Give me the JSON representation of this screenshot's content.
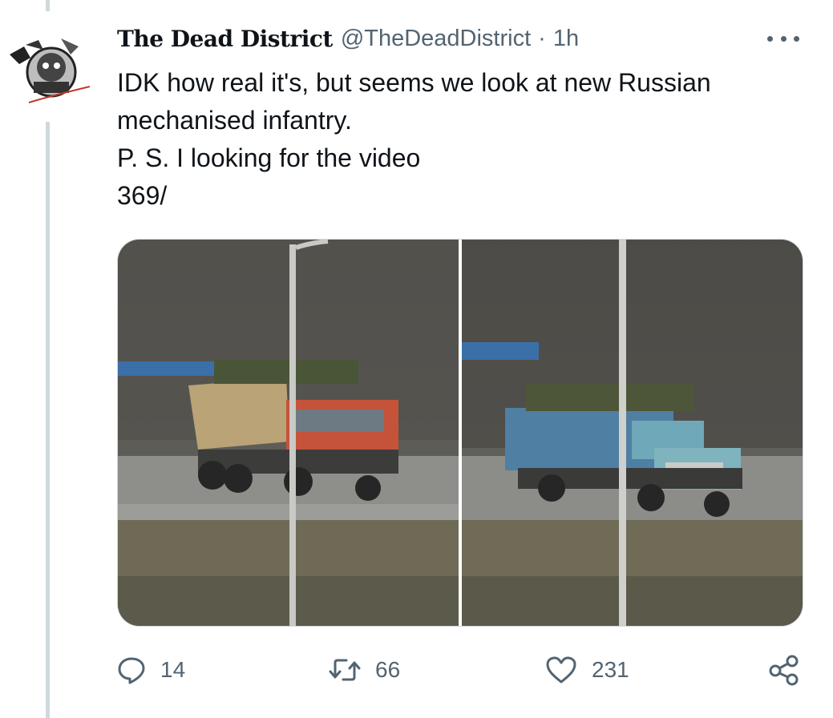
{
  "tweet": {
    "display_name": "The Dead District",
    "handle": "@TheDeadDistrict",
    "separator": "·",
    "time": "1h",
    "text_lines": [
      "IDK how real it's, but seems we look at new Russian",
      "mechanised infantry.",
      "P. S. I looking for the video",
      "369/"
    ]
  },
  "media": {
    "left_photo": "dump-truck-with-soldiers",
    "right_photo": "blue-truck-with-soldiers"
  },
  "actions": {
    "replies": "14",
    "retweets": "66",
    "likes": "231"
  },
  "colors": {
    "text": "#0f1419",
    "secondary": "#536471",
    "thread_line": "#cfd9de",
    "border": "#cfd9de"
  },
  "icons": [
    "more-icon",
    "reply-icon",
    "retweet-icon",
    "like-icon",
    "share-icon"
  ]
}
